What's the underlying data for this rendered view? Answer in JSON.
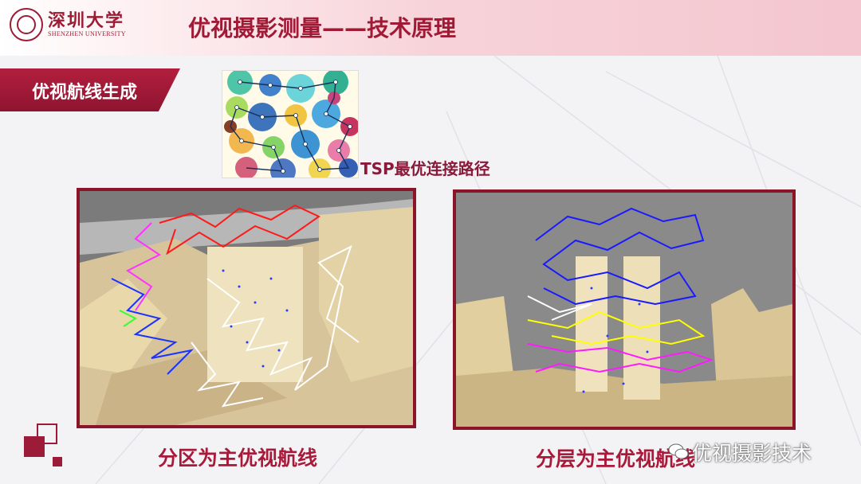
{
  "header": {
    "logo_cn": "深圳大学",
    "logo_en": "SHENZHEN UNIVERSITY",
    "title": "优视摄影测量——技术原理"
  },
  "section": {
    "label": "优视航线生成"
  },
  "tsp": {
    "caption": "TSP最优连接路径"
  },
  "figures": {
    "left_caption": "分区为主优视航线",
    "right_caption": "分层为主优视航线"
  },
  "watermark": {
    "text": "优视摄影技术",
    "icon": "wechat-icon"
  },
  "colors": {
    "accent": "#a01a36",
    "tab": "#9b1b38",
    "frame": "#8a1428"
  }
}
